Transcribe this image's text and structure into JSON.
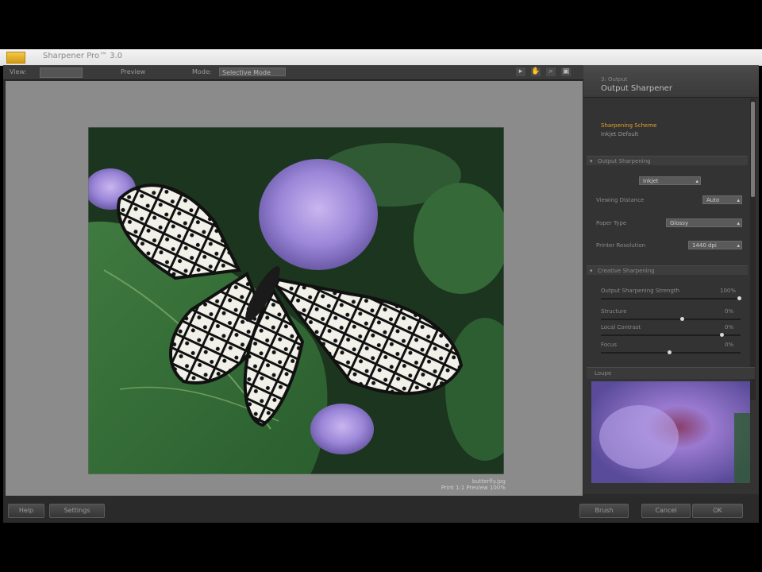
{
  "window": {
    "title": "Sharpener Pro™ 3.0"
  },
  "toolbar": {
    "view_label": "View:",
    "preview_label": "Preview",
    "mode_label": "Mode:",
    "mode_value": "Selective Mode"
  },
  "panel": {
    "subtitle": "3: Output",
    "title": "Output Sharpener",
    "highlight_line1": "Sharpening Scheme",
    "highlight_line2": "Inkjet Default",
    "section_general": "Output Sharpening",
    "dropdown_top": "Inkjet",
    "viewing_distance_label": "Viewing Distance",
    "viewing_distance_value": "Auto",
    "paper_type_label": "Paper Type",
    "paper_type_value": "Glossy",
    "printer_resolution_label": "Printer Resolution",
    "printer_resolution_value": "1440 dpi",
    "section_creative": "Creative Sharpening",
    "adaptive_label": "Output Sharpening Strength",
    "adaptive_value": "100%",
    "structure_label": "Structure",
    "structure_value": "0%",
    "local_contrast_label": "Local Contrast",
    "local_contrast_value": "0%",
    "focus_label": "Focus",
    "focus_value": "0%",
    "loupe_label": "Loupe"
  },
  "photo": {
    "caption_line1": "butterfly.jpg",
    "caption_line2": "Print 1:1 Preview 100%"
  },
  "buttons": {
    "help": "Help",
    "settings": "Settings",
    "brush": "Brush",
    "cancel": "Cancel",
    "ok": "OK"
  }
}
